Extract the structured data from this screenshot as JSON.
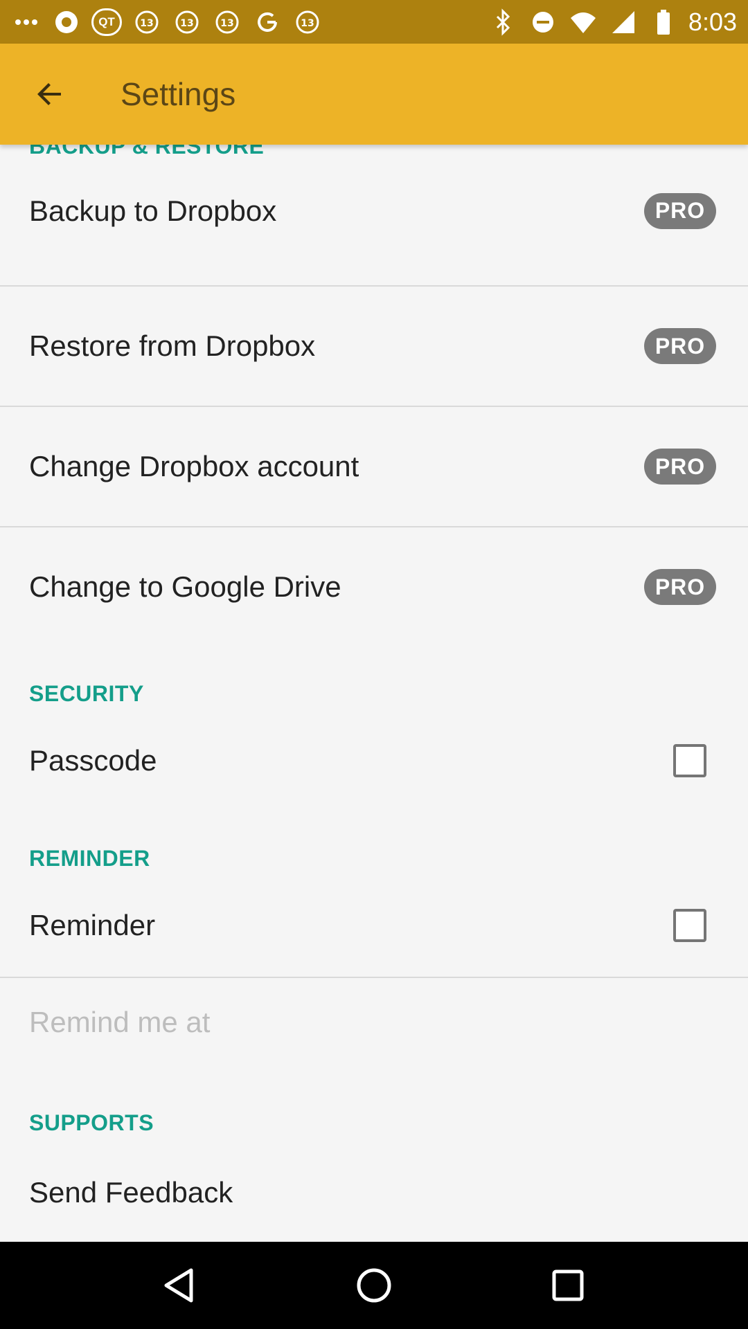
{
  "status_bar": {
    "time": "8:03",
    "left_icons": [
      "dots-icon",
      "phone-app-icon",
      "qt-icon",
      "abc13-icon",
      "abc13-icon",
      "abc13-icon",
      "google-g-icon",
      "abc13-icon"
    ],
    "right_icons": [
      "bluetooth-icon",
      "dnd-icon",
      "wifi-icon",
      "signal-icon",
      "battery-icon"
    ]
  },
  "app_bar": {
    "title": "Settings"
  },
  "sections": {
    "backup": {
      "header": "BACKUP & RESTORE",
      "items": [
        {
          "label": "Backup to Dropbox",
          "badge": "PRO"
        },
        {
          "label": "Restore from Dropbox",
          "badge": "PRO"
        },
        {
          "label": "Change Dropbox account",
          "badge": "PRO"
        },
        {
          "label": "Change to Google Drive",
          "badge": "PRO"
        }
      ]
    },
    "security": {
      "header": "SECURITY",
      "passcode_label": "Passcode",
      "passcode_checked": false
    },
    "reminder": {
      "header": "REMINDER",
      "reminder_label": "Reminder",
      "reminder_checked": false,
      "remind_me_at_label": "Remind me at"
    },
    "supports": {
      "header": "SUPPORTS",
      "send_feedback_label": "Send Feedback"
    }
  },
  "colors": {
    "app_bar": "#edb327",
    "status_bar": "#ad810f",
    "section_header": "#149e8a",
    "pro_badge": "#7a7a7a"
  }
}
